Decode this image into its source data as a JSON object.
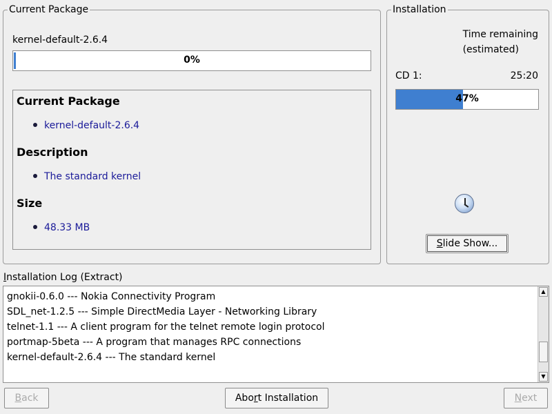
{
  "current_package": {
    "group_title": "Current Package",
    "package_name": "kernel-default-2.6.4",
    "progress_text": "0%",
    "progress_value": 0.0,
    "info": {
      "heading_package": "Current Package",
      "package": "kernel-default-2.6.4",
      "heading_description": "Description",
      "description": "The standard kernel",
      "heading_size": "Size",
      "size": "48.33 MB"
    }
  },
  "installation": {
    "group_title": "Installation",
    "time_remaining_label_1": "Time remaining",
    "time_remaining_label_2": "(estimated)",
    "cd_label": "CD 1:",
    "cd_time": "25:20",
    "cd_progress_text": "47%",
    "cd_progress_value": 0.47,
    "slide_show_prefix": "S",
    "slide_show_rest": "lide Show..."
  },
  "log": {
    "label_prefix": "I",
    "label_rest": "nstallation Log (Extract)",
    "lines": [
      "gnokii-0.6.0 --- Nokia Connectivity Program",
      "SDL_net-1.2.5 --- Simple DirectMedia Layer - Networking Library",
      "telnet-1.1 --- A client program for the telnet remote login protocol",
      "portmap-5beta --- A program that manages RPC connections",
      "kernel-default-2.6.4 --- The standard kernel"
    ]
  },
  "buttons": {
    "back_prefix": "B",
    "back_rest": "ack",
    "abort_pre": "Abo",
    "abort_u": "r",
    "abort_post": "t Installation",
    "next_prefix": "N",
    "next_rest": "ext"
  },
  "colors": {
    "progress_fill": "#3f7fd0",
    "info_text": "#1a1a99"
  },
  "icons": {
    "busy": "clock-icon"
  }
}
